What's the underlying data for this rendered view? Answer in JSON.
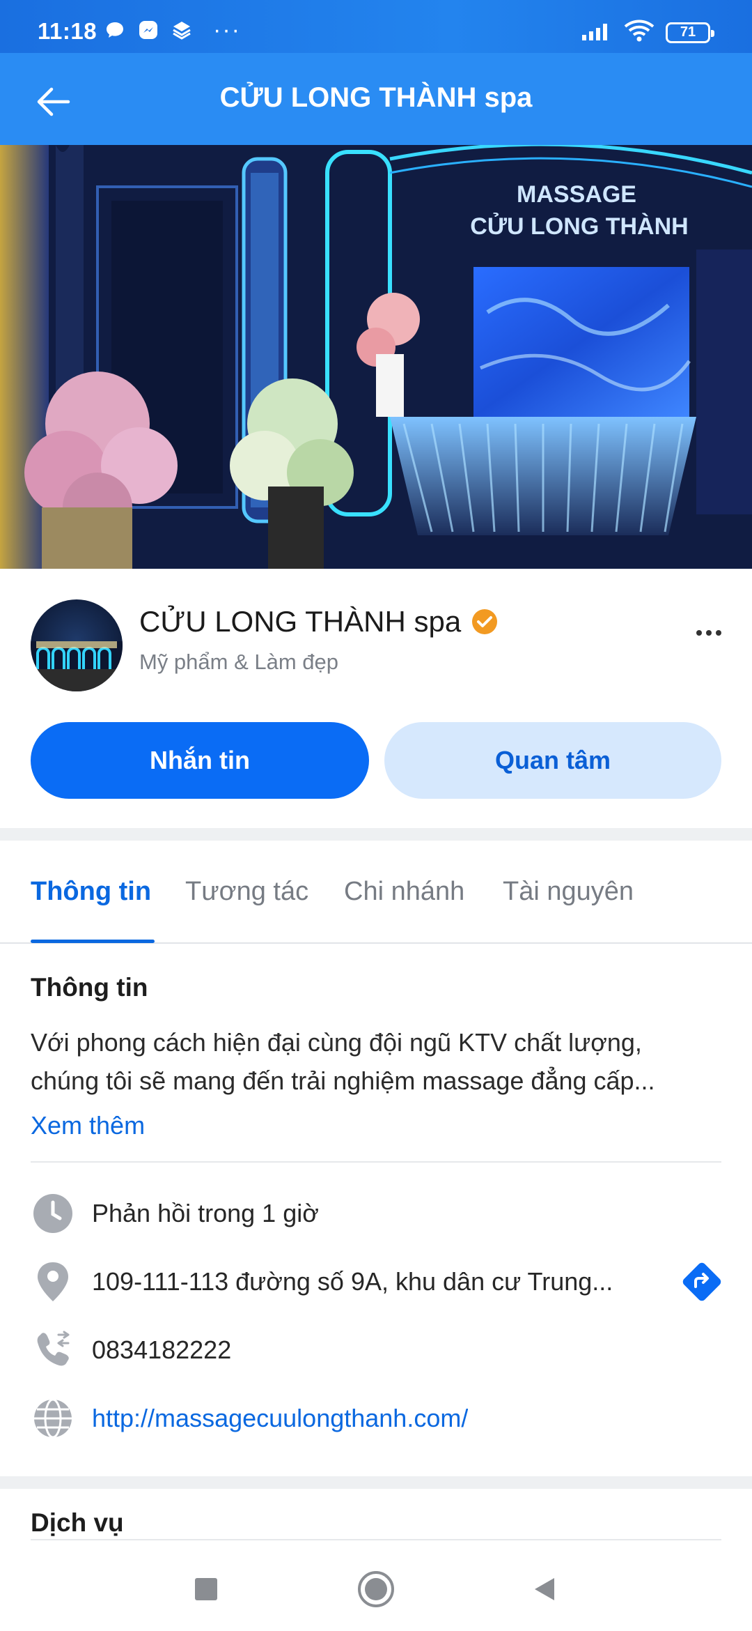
{
  "status_bar": {
    "time": "11:18",
    "left_icons": [
      "chat-bubble-icon",
      "messenger-icon",
      "layers-icon"
    ],
    "more": "···",
    "battery": "71",
    "right_icons": [
      "signal-icon",
      "wifi-icon",
      "battery-icon"
    ]
  },
  "header": {
    "title": "CỬU LONG THÀNH spa",
    "back_icon": "arrow-left-icon"
  },
  "cover": {
    "sign_line1": "MASSAGE",
    "sign_line2": "CỬU LONG THÀNH"
  },
  "profile": {
    "name": "CỬU LONG THÀNH spa",
    "category": "Mỹ phẩm & Làm đẹp",
    "verified_icon": "verified-badge-icon",
    "more_icon": "more-horizontal-icon",
    "message_button": "Nhắn tin",
    "follow_button": "Quan tâm"
  },
  "tabs": [
    {
      "label": "Thông tin",
      "active": true
    },
    {
      "label": "Tương tác",
      "active": false
    },
    {
      "label": "Chi nhánh",
      "active": false
    },
    {
      "label": "Tài nguyên",
      "active": false
    }
  ],
  "info": {
    "title": "Thông tin",
    "description_line1": "Với phong cách hiện đại cùng đội ngũ KTV chất lượng,",
    "description_line2": "chúng tôi sẽ mang đến trải nghiệm massage đẳng cấp...",
    "see_more": "Xem thêm",
    "response_time": "Phản hồi trong 1 giờ",
    "address": "109-111-113 đường số 9A, khu dân cư Trung...",
    "phone": "0834182222",
    "website": "http://massagecuulongthanh.com/"
  },
  "services": {
    "title": "Dịch vụ"
  },
  "colors": {
    "brand_blue": "#0a6cf5",
    "header_blue": "#2a8cf3",
    "light_blue": "#d6e8fd",
    "verified_orange": "#f29a22"
  }
}
